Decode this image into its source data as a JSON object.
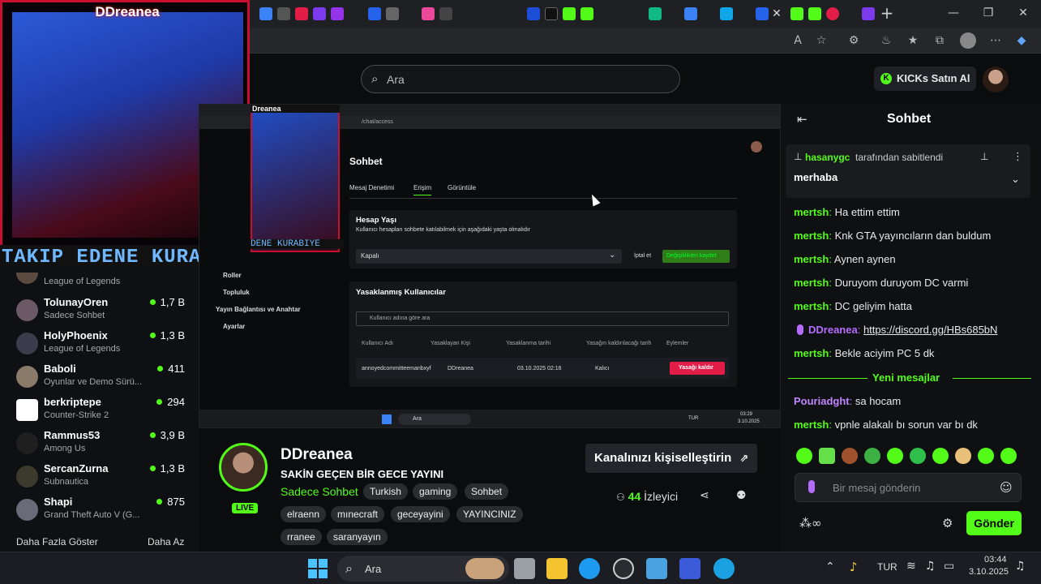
{
  "colors": {
    "kick_green": "#53fc18",
    "accent_red": "#e11d48",
    "banner_blue": "#6fb8ff"
  },
  "webcam": {
    "label": "DDreanea",
    "banner": "TAKIP EDENE KURABIYE"
  },
  "topbar": {
    "search_placeholder": "Ara",
    "buy_kicks": "KICKs Satın Al"
  },
  "sidebar": {
    "first_game": "League of Legends",
    "channels": [
      {
        "name": "TolunayOren",
        "game": "Sadece Sohbet",
        "viewers": "1,7 B"
      },
      {
        "name": "HolyPhoenix",
        "game": "League of Legends",
        "viewers": "1,3 B"
      },
      {
        "name": "Baboli",
        "game": "Oyunlar ve Demo Sürü...",
        "viewers": "411"
      },
      {
        "name": "berkriptepe",
        "game": "Counter-Strike 2",
        "viewers": "294"
      },
      {
        "name": "Rammus53",
        "game": "Among Us",
        "viewers": "3,9 B"
      },
      {
        "name": "SercanZurna",
        "game": "Subnautica",
        "viewers": "1,3 B"
      },
      {
        "name": "Shapi",
        "game": "Grand Theft Auto V (G...",
        "viewers": "875"
      }
    ],
    "show_more": "Daha Fazla Göster",
    "show_less": "Daha Az"
  },
  "inner": {
    "cam_banner": "DENE KURABIYE",
    "cam_label": "Dreanea",
    "address": "/chat/access",
    "title": "Sohbet",
    "tabs": [
      "Mesaj Denetimi",
      "Erişim",
      "Görüntüle"
    ],
    "side_menu": [
      "Roller",
      "Topluluk",
      "Yayın Bağlantısı ve Anahtar",
      "Ayarlar"
    ],
    "account_age_title": "Hesap Yaşı",
    "account_age_desc": "Kullanıcı hesapları sohbete katılabilmek için aşağıdaki yaşta olmalıdır",
    "select_value": "Kapalı",
    "cancel": "İptal et",
    "save": "Değişiklikleri kaydet",
    "banned_title": "Yasaklanmış Kullanıcılar",
    "banned_search": "Kullanıcı adına göre ara",
    "cols": [
      "Kullanıcı Adı",
      "Yasaklayan Kişi",
      "Yasaklanma tarihi",
      "Yasağın kaldırılacağı tarih",
      "Eylemler"
    ],
    "row": {
      "user": "annoyedcommitteemanbxyf",
      "by": "DDreanea",
      "date": "03.10.2025 02:16",
      "until": "Kalıcı",
      "action": "Yasağı kaldır"
    },
    "taskbar_search": "Ara",
    "lang": "TUR",
    "time": "03:29",
    "date": "3.10.2025"
  },
  "stream": {
    "name": "DDreanea",
    "title": "SAKİN GEÇEN BİR GECE YAYINI",
    "category": "Sadece Sohbet",
    "live": "LIVE",
    "tags": [
      "Turkish",
      "gaming",
      "Sohbet",
      "elraenn",
      "mınecraft",
      "geceyayini",
      "YAYINCINIZ",
      "rranee",
      "saranyayın"
    ],
    "customize": "Kanalınızı kişiselleştirin",
    "viewers": "44",
    "viewers_label": "İzleyici"
  },
  "chat": {
    "title": "Sohbet",
    "pinned_by_user": "hasanygc",
    "pinned_by_text": "tarafından sabitlendi",
    "pinned_message": "merhaba",
    "messages": [
      {
        "user": "mertsh",
        "text": "Ha ettim ettim",
        "color": "#53fc18"
      },
      {
        "user": "mertsh",
        "text": "Knk GTA yayıncıların dan buldum",
        "color": "#53fc18"
      },
      {
        "user": "mertsh",
        "text": "Aynen aynen",
        "color": "#53fc18"
      },
      {
        "user": "mertsh",
        "text": "Duruyom duruyom DC varmi",
        "color": "#53fc18"
      },
      {
        "user": "mertsh",
        "text": "DC geliyim hatta",
        "color": "#53fc18"
      },
      {
        "user": "DDreanea",
        "text": "https://discord.gg/HBs685bN",
        "color": "#b46cff"
      },
      {
        "user": "mertsh",
        "text": "Bekle aciyim PC 5 dk",
        "color": "#53fc18"
      }
    ],
    "new_messages": "Yeni mesajlar",
    "messages_after": [
      {
        "user": "Pouriadght",
        "text": "sa hocam",
        "color": "#c084fc"
      },
      {
        "user": "mertsh",
        "text": "vpnle alakalı bı sorun var bı dk",
        "color": "#53fc18"
      }
    ],
    "input_placeholder": "Bir mesaj gönderin",
    "send": "Gönder"
  },
  "taskbar": {
    "search": "Ara",
    "lang": "TUR",
    "time": "03:44",
    "date": "3.10.2025"
  }
}
